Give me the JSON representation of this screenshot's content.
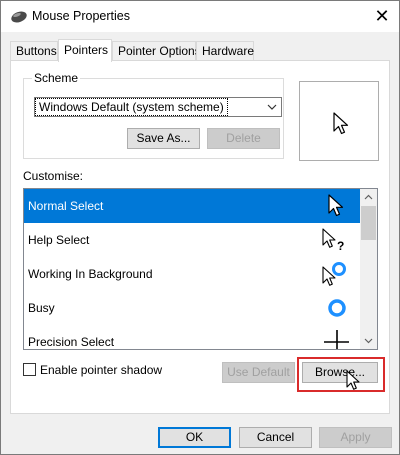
{
  "window": {
    "title": "Mouse Properties",
    "close_glyph": "✕"
  },
  "tabs": [
    {
      "label": "Buttons"
    },
    {
      "label": "Pointers"
    },
    {
      "label": "Pointer Options"
    },
    {
      "label": "Hardware"
    }
  ],
  "active_tab": "Pointers",
  "scheme": {
    "group_label": "Scheme",
    "selected_value": "Windows Default (system scheme)",
    "save_as_label": "Save As...",
    "delete_label": "Delete"
  },
  "customise": {
    "label": "Customise:",
    "items": [
      {
        "label": "Normal Select",
        "cursor": "arrow-icon",
        "selected": true
      },
      {
        "label": "Help Select",
        "cursor": "help-select-icon",
        "selected": false
      },
      {
        "label": "Working In Background",
        "cursor": "working-in-background-icon",
        "selected": false
      },
      {
        "label": "Busy",
        "cursor": "busy-ring-icon",
        "selected": false
      },
      {
        "label": "Precision Select",
        "cursor": "crosshair-icon",
        "selected": false
      }
    ]
  },
  "pointer_shadow": {
    "label": "Enable pointer shadow",
    "checked": false
  },
  "use_default_label": "Use Default",
  "browse_label": "Browse...",
  "footer": {
    "ok_label": "OK",
    "cancel_label": "Cancel",
    "apply_label": "Apply"
  },
  "colors": {
    "accent": "#0078d7",
    "highlight_border": "#d92b2b",
    "busy_ring": "#1e90ff"
  }
}
